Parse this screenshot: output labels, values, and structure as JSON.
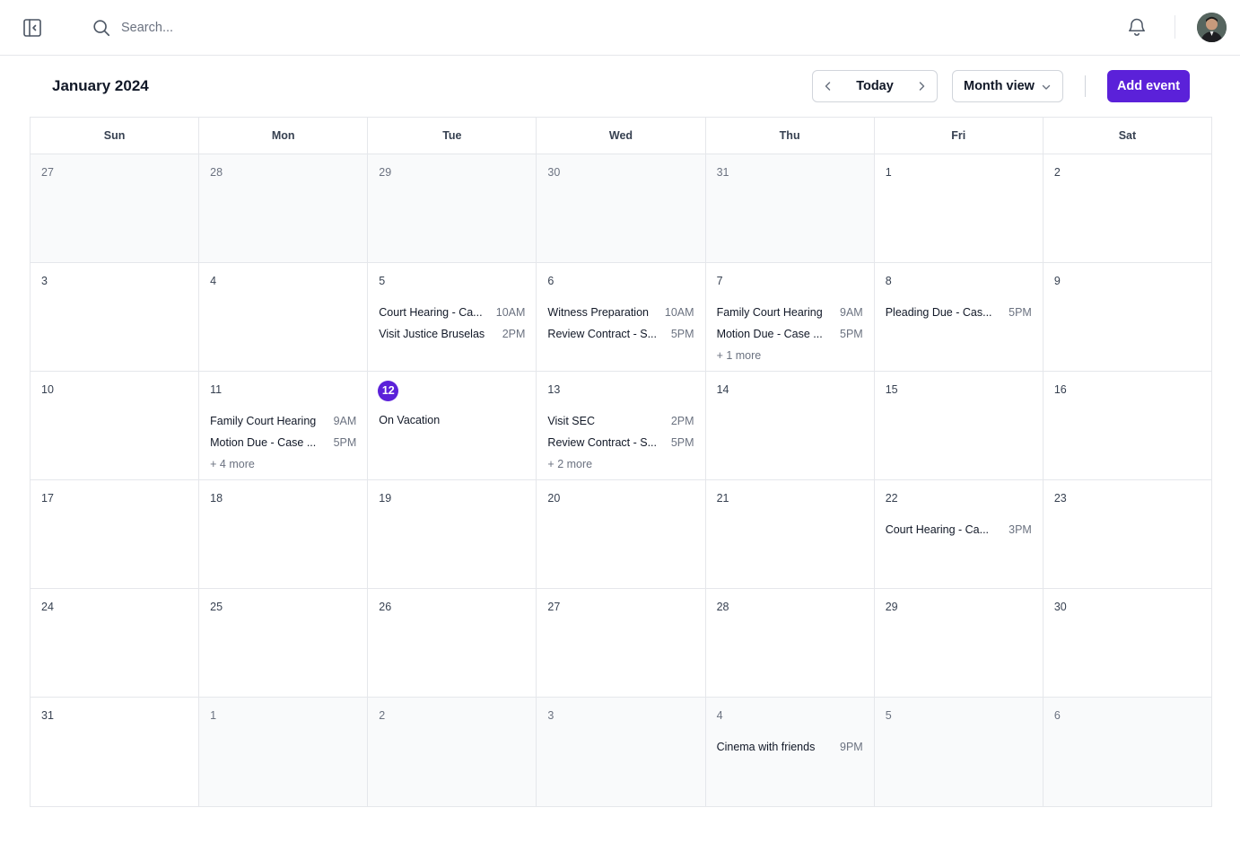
{
  "search": {
    "placeholder": "Search..."
  },
  "icons": {
    "sidebar_toggle": "sidebar-collapse-icon",
    "search": "search-icon",
    "bell": "bell-icon",
    "prev": "chevron-left-icon",
    "next": "chevron-right-icon",
    "view_dropdown": "chevron-down-icon"
  },
  "colors": {
    "accent": "#5b21d9",
    "outside_bg": "#f9fafb",
    "border": "#e5e7eb"
  },
  "calendar": {
    "title": "January 2024",
    "today_label": "Today",
    "view_label": "Month view",
    "add_label": "Add event",
    "days_of_week": [
      "Sun",
      "Mon",
      "Tue",
      "Wed",
      "Thu",
      "Fri",
      "Sat"
    ],
    "weeks": [
      [
        {
          "day": "27",
          "outside": true,
          "events": []
        },
        {
          "day": "28",
          "outside": true,
          "events": []
        },
        {
          "day": "29",
          "outside": true,
          "events": []
        },
        {
          "day": "30",
          "outside": true,
          "events": []
        },
        {
          "day": "31",
          "outside": true,
          "events": []
        },
        {
          "day": "1",
          "events": []
        },
        {
          "day": "2",
          "events": []
        }
      ],
      [
        {
          "day": "3",
          "events": []
        },
        {
          "day": "4",
          "events": []
        },
        {
          "day": "5",
          "events": [
            {
              "title": "Court Hearing - Ca...",
              "time": "10AM"
            },
            {
              "title": "Visit Justice Bruselas",
              "time": "2PM"
            }
          ]
        },
        {
          "day": "6",
          "events": [
            {
              "title": "Witness Preparation",
              "time": "10AM"
            },
            {
              "title": "Review Contract - S...",
              "time": "5PM"
            }
          ]
        },
        {
          "day": "7",
          "events": [
            {
              "title": "Family Court Hearing",
              "time": "9AM"
            },
            {
              "title": "Motion Due - Case ...",
              "time": "5PM"
            }
          ],
          "more": "+ 1 more"
        },
        {
          "day": "8",
          "events": [
            {
              "title": "Pleading Due - Cas...",
              "time": "5PM"
            }
          ]
        },
        {
          "day": "9",
          "events": []
        }
      ],
      [
        {
          "day": "10",
          "events": []
        },
        {
          "day": "11",
          "events": [
            {
              "title": "Family Court Hearing",
              "time": "9AM"
            },
            {
              "title": "Motion Due - Case ...",
              "time": "5PM"
            }
          ],
          "more": "+ 4 more"
        },
        {
          "day": "12",
          "today": true,
          "events": [
            {
              "title": "On Vacation",
              "time": ""
            }
          ]
        },
        {
          "day": "13",
          "events": [
            {
              "title": "Visit SEC",
              "time": "2PM"
            },
            {
              "title": "Review Contract - S...",
              "time": "5PM"
            }
          ],
          "more": "+ 2 more"
        },
        {
          "day": "14",
          "events": []
        },
        {
          "day": "15",
          "events": []
        },
        {
          "day": "16",
          "events": []
        }
      ],
      [
        {
          "day": "17",
          "events": []
        },
        {
          "day": "18",
          "events": []
        },
        {
          "day": "19",
          "events": []
        },
        {
          "day": "20",
          "events": []
        },
        {
          "day": "21",
          "events": []
        },
        {
          "day": "22",
          "events": [
            {
              "title": "Court Hearing - Ca...",
              "time": "3PM"
            }
          ]
        },
        {
          "day": "23",
          "events": []
        }
      ],
      [
        {
          "day": "24",
          "events": []
        },
        {
          "day": "25",
          "events": []
        },
        {
          "day": "26",
          "events": []
        },
        {
          "day": "27",
          "events": []
        },
        {
          "day": "28",
          "events": []
        },
        {
          "day": "29",
          "events": []
        },
        {
          "day": "30",
          "events": []
        }
      ],
      [
        {
          "day": "31",
          "events": []
        },
        {
          "day": "1",
          "outside": true,
          "events": []
        },
        {
          "day": "2",
          "outside": true,
          "events": []
        },
        {
          "day": "3",
          "outside": true,
          "events": []
        },
        {
          "day": "4",
          "outside": true,
          "events": [
            {
              "title": "Cinema with friends",
              "time": "9PM"
            }
          ]
        },
        {
          "day": "5",
          "outside": true,
          "events": []
        },
        {
          "day": "6",
          "outside": true,
          "events": []
        }
      ]
    ]
  }
}
